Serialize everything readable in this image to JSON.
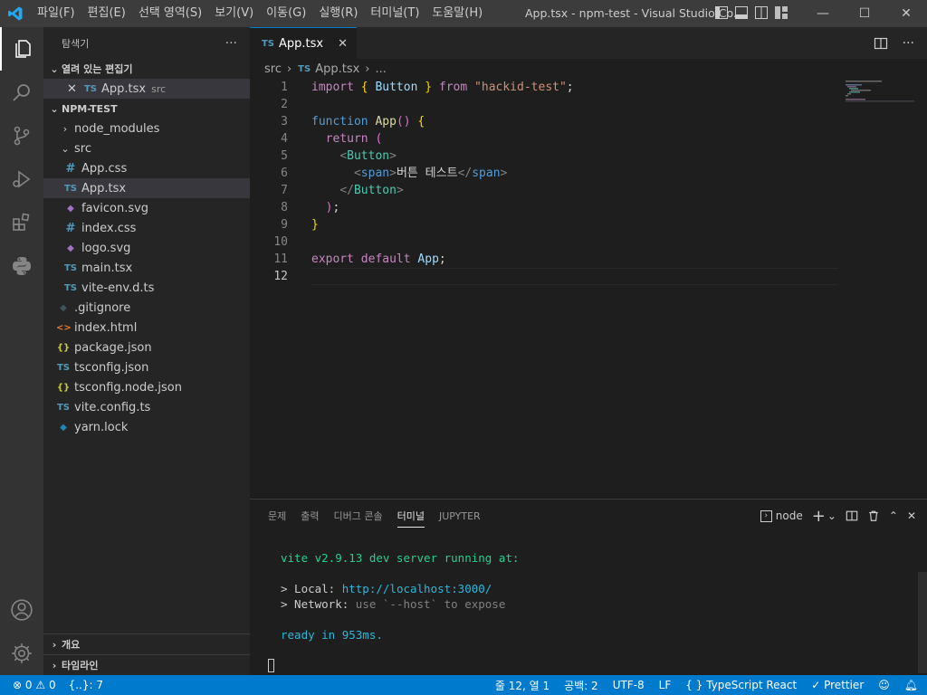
{
  "titlebar": {
    "menu": [
      "파일(F)",
      "편집(E)",
      "선택 영역(S)",
      "보기(V)",
      "이동(G)",
      "실행(R)",
      "터미널(T)",
      "도움말(H)"
    ],
    "title": "App.tsx - npm-test - Visual Studio Co...",
    "minimize": "—",
    "maximize": "☐",
    "close": "✕"
  },
  "activity": [
    "files-icon",
    "search-icon",
    "source-control-icon",
    "run-debug-icon",
    "extensions-icon",
    "python-icon",
    "account-icon",
    "settings-gear-icon"
  ],
  "sidebar": {
    "title": "탐색기",
    "more": "···",
    "open_editors": {
      "label": "열려 있는 편집기",
      "items": [
        {
          "icon": "TS",
          "name": "App.tsx",
          "desc": "src"
        }
      ]
    },
    "folder": {
      "label": "NPM-TEST",
      "items": [
        {
          "name": "node_modules",
          "type": "folder-closed"
        },
        {
          "name": "src",
          "type": "folder-open"
        },
        {
          "name": "App.css",
          "type": "css",
          "icon": "#"
        },
        {
          "name": "App.tsx",
          "type": "ts",
          "icon": "TS"
        },
        {
          "name": "favicon.svg",
          "type": "svg",
          "icon": "◆"
        },
        {
          "name": "index.css",
          "type": "css",
          "icon": "#"
        },
        {
          "name": "logo.svg",
          "type": "svg",
          "icon": "◆"
        },
        {
          "name": "main.tsx",
          "type": "ts",
          "icon": "TS"
        },
        {
          "name": "vite-env.d.ts",
          "type": "ts",
          "icon": "TS"
        },
        {
          "name": ".gitignore",
          "type": "git",
          "icon": "◆"
        },
        {
          "name": "index.html",
          "type": "html",
          "icon": "<>"
        },
        {
          "name": "package.json",
          "type": "json",
          "icon": "{}"
        },
        {
          "name": "tsconfig.json",
          "type": "ts",
          "icon": "TS"
        },
        {
          "name": "tsconfig.node.json",
          "type": "json",
          "icon": "{}"
        },
        {
          "name": "vite.config.ts",
          "type": "ts",
          "icon": "TS"
        },
        {
          "name": "yarn.lock",
          "type": "yarn",
          "icon": "◆"
        }
      ]
    },
    "outline": "개요",
    "timeline": "타임라인"
  },
  "editor": {
    "tab": {
      "icon": "TS",
      "label": "App.tsx",
      "close": "✕"
    },
    "breadcrumb": {
      "folder": "src",
      "icon": "TS",
      "file": "App.tsx",
      "more": "..."
    },
    "line_numbers": [
      "1",
      "2",
      "3",
      "4",
      "5",
      "6",
      "7",
      "8",
      "9",
      "10",
      "11",
      "12"
    ],
    "code": {
      "l1_import": "import",
      "l1_ob": "{",
      "l1_button": "Button",
      "l1_cb": "}",
      "l1_from": "from",
      "l1_str": "\"hackid-test\"",
      "l1_semi": ";",
      "l3_function": "function",
      "l3_name": "App",
      "l3_parens": "()",
      "l3_brace": "{",
      "l4_return": "return",
      "l4_paren": "(",
      "l5_lt": "<",
      "l5_tag": "Button",
      "l5_gt": ">",
      "l6_lt": "<",
      "l6_tag": "span",
      "l6_gt": ">",
      "l6_text": "버튼 테스트",
      "l6_close_lt": "</",
      "l6_close_tag": "span",
      "l6_close_gt": ">",
      "l7_lt": "</",
      "l7_tag": "Button",
      "l7_gt": ">",
      "l8_paren": ")",
      "l8_semi": ";",
      "l9_brace": "}",
      "l11_export": "export",
      "l11_default": "default",
      "l11_app": "App",
      "l11_semi": ";"
    }
  },
  "panel": {
    "tabs": [
      "문제",
      "출력",
      "디버그 콘솔",
      "터미널",
      "JUPYTER"
    ],
    "active_tab": "터미널",
    "terminal_name": "node",
    "terminal": {
      "vite_line": "vite v2.9.13 dev server running at:",
      "local_label": "> Local: ",
      "local_url": "http://localhost:3000/",
      "network_label": "> Network: ",
      "network_text": "use `--host` to expose",
      "ready_line": "ready in 953ms."
    }
  },
  "statusbar": {
    "errors": "0",
    "warnings": "0",
    "braces": "{..}: 7",
    "position": "줄 12, 열 1",
    "spaces": "공백: 2",
    "encoding": "UTF-8",
    "eol": "LF",
    "language": "TypeScript React",
    "prettier": "Prettier"
  },
  "colors": {
    "accent": "#007acc",
    "titlebar": "#3c3c3c",
    "activitybar": "#333333",
    "sidebar": "#252526",
    "editor": "#1e1e1e"
  }
}
